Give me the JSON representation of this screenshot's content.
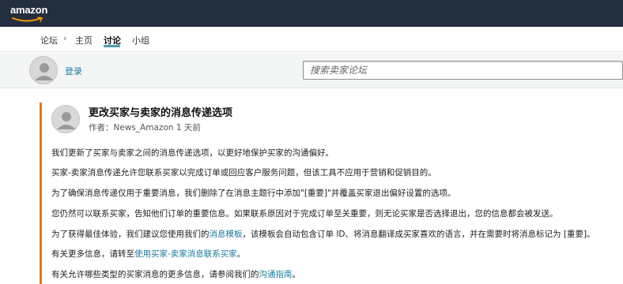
{
  "header": {
    "logo_text": "amazon"
  },
  "nav": {
    "items": [
      {
        "label": "论坛"
      },
      {
        "label": "主页"
      },
      {
        "label": "讨论"
      },
      {
        "label": "小组"
      }
    ],
    "separator": "›"
  },
  "userbar": {
    "login_label": "登录",
    "search_placeholder": "搜索卖家论坛"
  },
  "post": {
    "title": "更改买家与卖家的消息传递选项",
    "author_prefix": "作者：",
    "author": "News_Amazon",
    "time": "1 天前",
    "paragraphs": {
      "p1": "我们更新了买家与卖家之间的消息传递选项，以更好地保护买家的沟通偏好。",
      "p2": "买家-卖家消息传递允许您联系买家以完成订单或回应客户服务问题，但该工具不应用于营销和促销目的。",
      "p3": "为了确保消息传递仅用于重要消息，我们删除了在消息主题行中添加\"[重要]\"并覆盖买家退出偏好设置的选项。",
      "p4": "您仍然可以联系买家，告知他们订单的重要信息。如果联系原因对于完成订单至关重要，则无论买家是否选择退出，您的信息都会被发送。",
      "p5_a": "为了获得最佳体验，我们建议您使用我们的",
      "p5_link": "消息模板",
      "p5_b": "，该模板会自动包含订单 ID、将消息翻译成买家喜欢的语言，并在需要时将消息标记为 [重要]。",
      "p6_a": "有关更多信息，请转至",
      "p6_link": "使用买家-卖家消息联系买家",
      "p6_b": "。",
      "p7_a": "有关允许哪些类型的买家消息的更多信息，请参阅我们的",
      "p7_link": "沟通指南",
      "p7_b": "。"
    }
  },
  "colors": {
    "topbar": "#232f3e",
    "accent_bar": "#e47911",
    "link": "#1b7b9e",
    "tab_underline": "#4a9eb0"
  }
}
